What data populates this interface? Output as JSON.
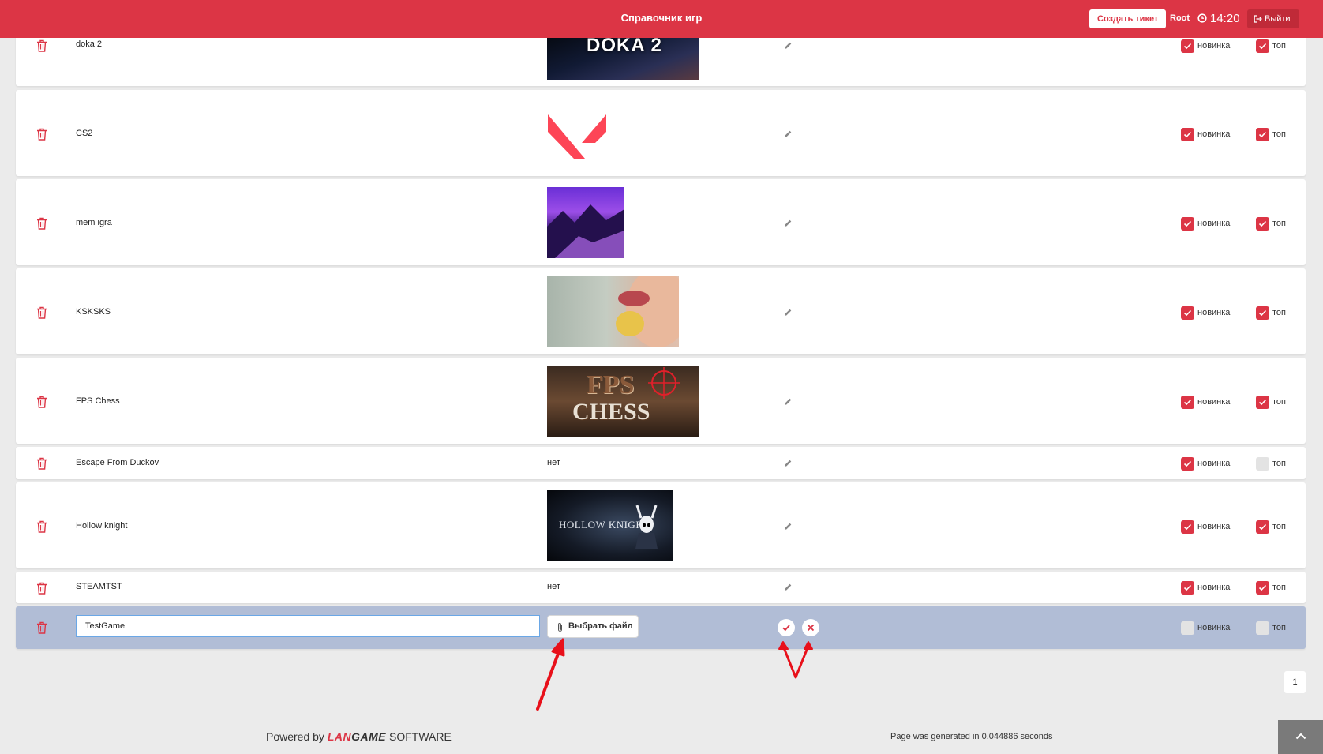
{
  "header": {
    "title": "Справочник игр",
    "create_ticket": "Создать тикет",
    "user": "Root",
    "time": "14:20",
    "logout": "Выйти"
  },
  "labels": {
    "novelty": "новинка",
    "top": "топ"
  },
  "games": [
    {
      "name": "doka 2",
      "image": "dota",
      "novelty": true,
      "top": true
    },
    {
      "name": "CS2",
      "image": "valorant-logo",
      "novelty": true,
      "top": true
    },
    {
      "name": "mem igra",
      "image": "purple-landscape",
      "novelty": true,
      "top": true
    },
    {
      "name": "KSKSKS",
      "image": "eating-chips",
      "novelty": true,
      "top": true
    },
    {
      "name": "FPS Chess",
      "image": "fps-chess",
      "novelty": true,
      "top": true
    },
    {
      "name": "Escape From Duckov",
      "image_text": "нет",
      "novelty": true,
      "top": false
    },
    {
      "name": "Hollow knight",
      "image": "hollow-knight",
      "novelty": true,
      "top": true
    },
    {
      "name": "STEAMTST",
      "image_text": "нет",
      "novelty": true,
      "top": true
    }
  ],
  "image_captions": {
    "dota": "DOKA 2",
    "fps_chess_line1": "FPS",
    "fps_chess_line2": "CHESS",
    "hollow_knight": "HOLLOW KNIGHT"
  },
  "edit_row": {
    "name_value": "TestGame",
    "choose_file": "Выбрать файл",
    "novelty": false,
    "top": false
  },
  "pagination": {
    "current_page": "1"
  },
  "footer": {
    "powered_prefix": "Powered by",
    "brand_lan": "LAN",
    "brand_game": "GAME",
    "brand_suffix": "SOFTWARE",
    "generated": "Page was generated in 0.044886 seconds"
  },
  "colors": {
    "accent": "#dc3545",
    "edit_row_bg": "#b1bdd6",
    "page_bg": "#ebebeb"
  }
}
